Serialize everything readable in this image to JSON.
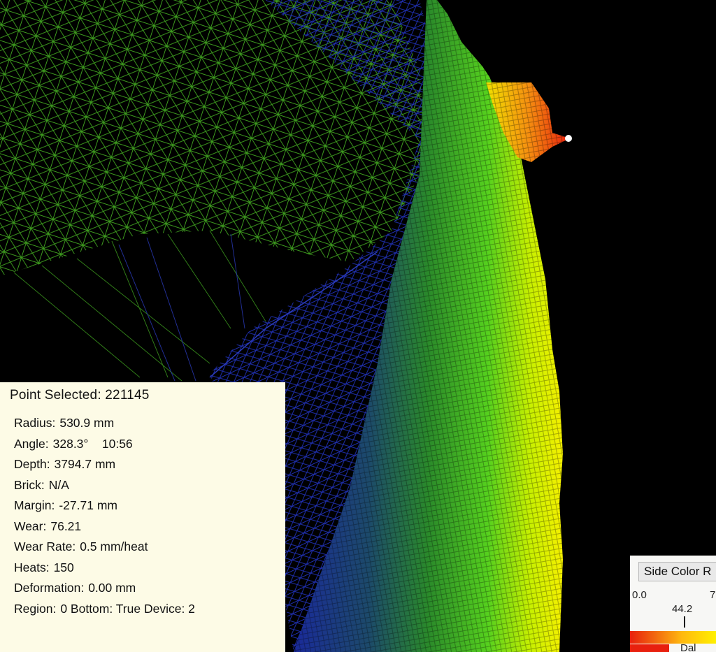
{
  "info_panel": {
    "title": "Point Selected: 221145",
    "rows": [
      {
        "label": "Radius:",
        "value": "530.9 mm"
      },
      {
        "label": "Angle:",
        "value": "328.3°    10:56"
      },
      {
        "label": "Depth:",
        "value": "3794.7 mm"
      },
      {
        "label": "Brick:",
        "value": "N/A"
      },
      {
        "label": "Margin:",
        "value": "-27.71 mm"
      },
      {
        "label": "Wear:",
        "value": "76.21"
      },
      {
        "label": "Wear Rate:",
        "value": "0.5 mm/heat"
      },
      {
        "label": "Heats:",
        "value": "150"
      },
      {
        "label": "Deformation:",
        "value": "0.00 mm"
      },
      {
        "label": "Region:",
        "value": "0 Bottom: True Device: 2"
      }
    ]
  },
  "color_panel": {
    "title": "Side Color R",
    "min": "0.0",
    "max": "7",
    "marker_value": "44.2",
    "swatch_label": "Dal",
    "gradient_colors": [
      "#e8200e",
      "#f26a0f",
      "#ffb80f",
      "#fff000"
    ]
  },
  "scene": {
    "background": "#000000",
    "mesh_colors": {
      "green": "#3f9a20",
      "blue": "#1f2fae",
      "yellow": "#f0f000",
      "red": "#e8200e"
    },
    "selected_point_color": "#ffffff"
  }
}
